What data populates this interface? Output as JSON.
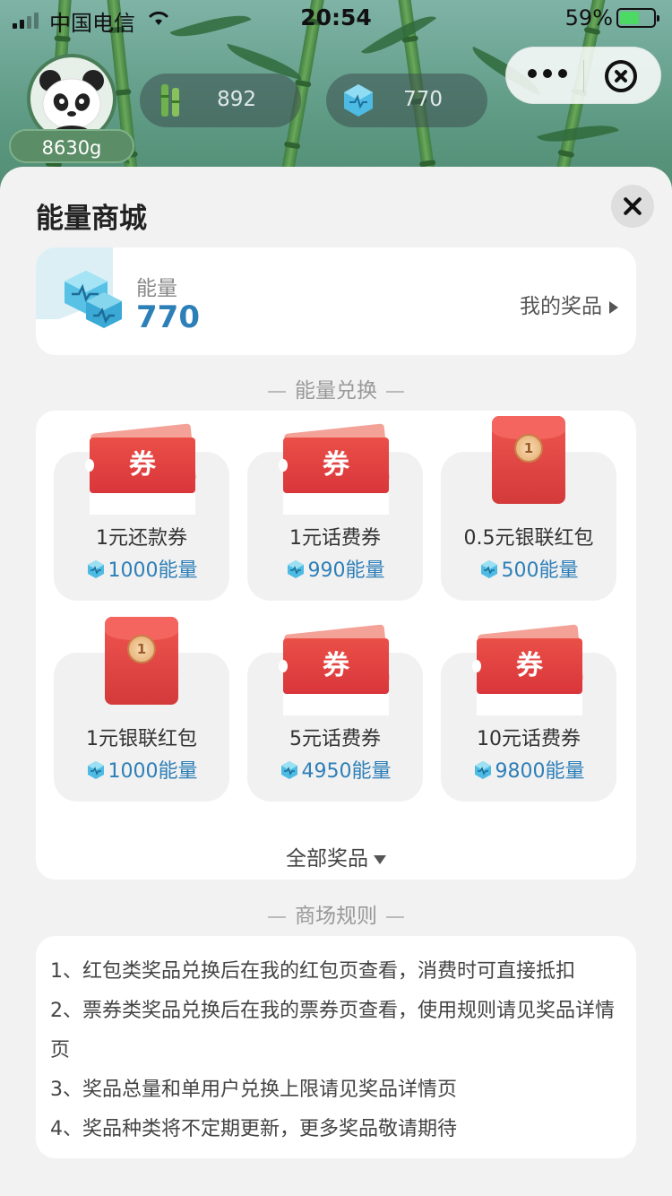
{
  "status_bar": {
    "carrier": "中国电信",
    "time": "20:54",
    "battery_percent": "59%",
    "battery_level": 0.59
  },
  "header": {
    "weight": "8630g",
    "bamboo_count": "892",
    "energy_count": "770"
  },
  "sheet": {
    "title": "能量商城",
    "energy_label": "能量",
    "energy_value": "770",
    "my_prizes": "我的奖品",
    "exchange_section": "能量兑换",
    "items": [
      {
        "name": "1元还款券",
        "price": "1000能量",
        "kind": "coupon",
        "badge": "券"
      },
      {
        "name": "1元话费券",
        "price": "990能量",
        "kind": "coupon",
        "badge": "券"
      },
      {
        "name": "0.5元银联红包",
        "price": "500能量",
        "kind": "envelope",
        "badge": "1"
      },
      {
        "name": "1元银联红包",
        "price": "1000能量",
        "kind": "envelope",
        "badge": "1"
      },
      {
        "name": "5元话费券",
        "price": "4950能量",
        "kind": "coupon",
        "badge": "券"
      },
      {
        "name": "10元话费券",
        "price": "9800能量",
        "kind": "coupon",
        "badge": "券"
      }
    ],
    "all_prizes": "全部奖品",
    "rules_section": "商场规则",
    "rules": [
      "1、红包类奖品兑换后在我的红包页查看，消费时可直接抵扣",
      "2、票券类奖品兑换后在我的票券页查看，使用规则请见奖品详情页",
      "3、奖品总量和单用户兑换上限请见奖品详情页",
      "4、奖品种类将不定期更新，更多奖品敬请期待"
    ]
  },
  "icons": {
    "bamboo": "bamboo-icon",
    "energy": "energy-gem-icon",
    "more": "more-dots-icon",
    "close_capsule": "close-circle-icon",
    "close_sheet": "close-icon"
  },
  "colors": {
    "accent_blue": "#2d7fb8",
    "coupon_red": "#e0403f",
    "sheet_bg": "#f2f2f2"
  }
}
